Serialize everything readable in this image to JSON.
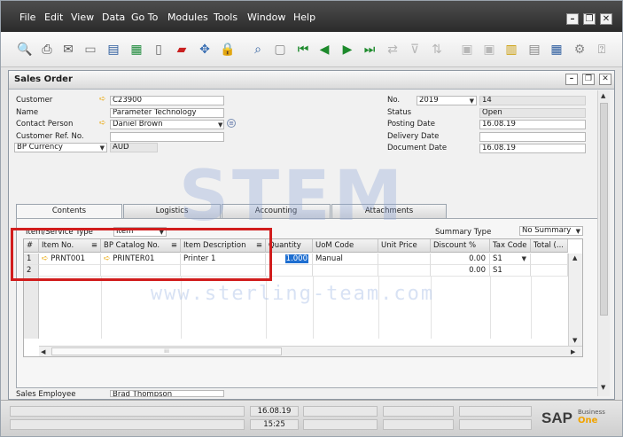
{
  "menubar": {
    "items": [
      {
        "label": "File"
      },
      {
        "label": "Edit"
      },
      {
        "label": "View"
      },
      {
        "label": "Data"
      },
      {
        "label": "Go To"
      },
      {
        "label": "Modules"
      },
      {
        "label": "Tools"
      },
      {
        "label": "Window"
      },
      {
        "label": "Help"
      }
    ]
  },
  "window": {
    "title": "Sales Order"
  },
  "header_left": {
    "customer": {
      "label": "Customer",
      "value": "C23900"
    },
    "name": {
      "label": "Name",
      "value": "Parameter Technology"
    },
    "contact_person": {
      "label": "Contact Person",
      "value": "Daniel Brown"
    },
    "customer_ref": {
      "label": "Customer Ref. No.",
      "value": ""
    },
    "currency": {
      "label": "BP Currency",
      "value": "AUD"
    }
  },
  "header_right": {
    "no": {
      "label": "No.",
      "series": "2019",
      "value": "14"
    },
    "status": {
      "label": "Status",
      "value": "Open"
    },
    "posting_date": {
      "label": "Posting Date",
      "value": "16.08.19"
    },
    "delivery_date": {
      "label": "Delivery Date",
      "value": ""
    },
    "document_date": {
      "label": "Document Date",
      "value": "16.08.19"
    }
  },
  "tabs": [
    {
      "label": "Contents"
    },
    {
      "label": "Logistics"
    },
    {
      "label": "Accounting"
    },
    {
      "label": "Attachments"
    }
  ],
  "contents": {
    "item_service_type_label": "Item/Service Type",
    "item_service_type_value": "Item",
    "summary_type_label": "Summary Type",
    "summary_type_value": "No Summary",
    "columns": [
      "#",
      "Item No.",
      "BP Catalog No.",
      "Item Description",
      "Quantity",
      "UoM Code",
      "Unit Price",
      "Discount %",
      "Tax Code",
      "Total (..."
    ],
    "rows": [
      {
        "num": "1",
        "item_no": "PRNT001",
        "bp_catalog": "PRINTER01",
        "description": "Printer 1",
        "quantity": "1.000",
        "uom": "Manual",
        "unit_price": "",
        "discount": "0.00",
        "tax": "S1",
        "total": ""
      },
      {
        "num": "2",
        "item_no": "",
        "bp_catalog": "",
        "description": "",
        "quantity": "",
        "uom": "",
        "unit_price": "",
        "discount": "0.00",
        "tax": "S1",
        "total": ""
      }
    ]
  },
  "footer": {
    "sales_employee_label": "Sales Employee",
    "sales_employee_value": "Brad Thompson"
  },
  "statusbar": {
    "date": "16.08.19",
    "time": "15:25",
    "brand": "SAP",
    "product_top": "Business",
    "product_bottom": "One"
  },
  "watermark": {
    "logo": "STEM",
    "url": "www.sterling-team.com"
  },
  "colors": {
    "highlight_box": "#d11d1d",
    "link_arrow": "#e9a400",
    "quantity_selection": "#1f6fd1"
  }
}
